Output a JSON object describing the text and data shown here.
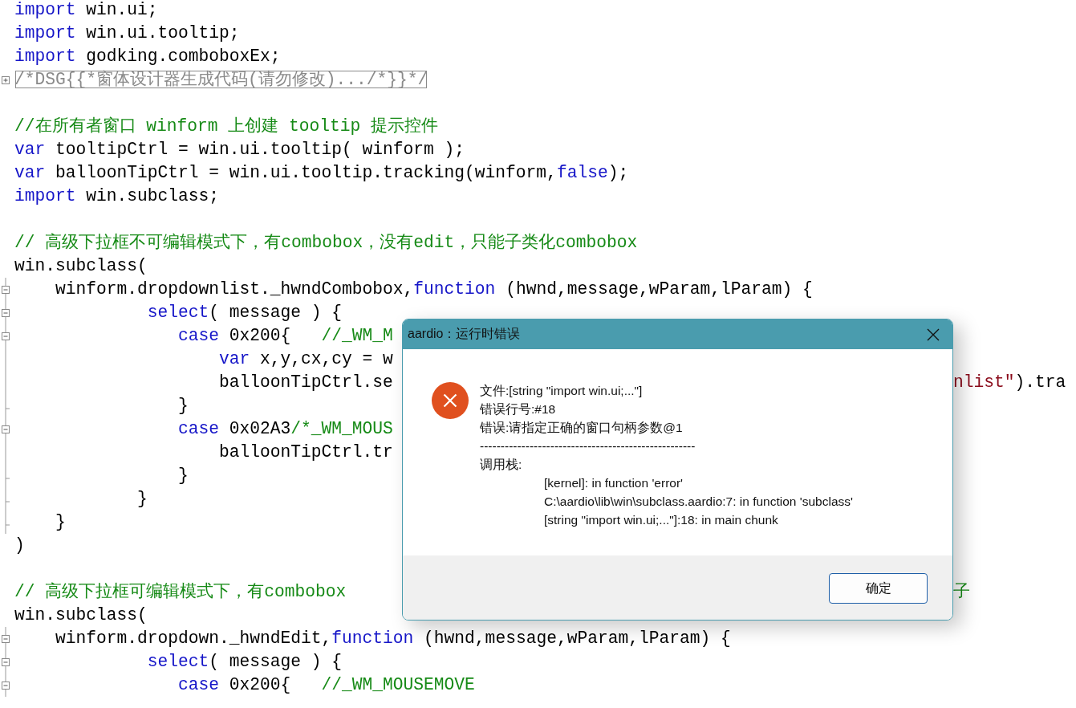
{
  "editor": {
    "lines": [
      {
        "kind": "code",
        "tokens": [
          {
            "kind": "keyword",
            "text": "import"
          },
          {
            "kind": "plain",
            "text": " win.ui;"
          }
        ]
      },
      {
        "kind": "code",
        "tokens": [
          {
            "kind": "keyword",
            "text": "import"
          },
          {
            "kind": "plain",
            "text": " win.ui.tooltip;"
          }
        ]
      },
      {
        "kind": "code",
        "tokens": [
          {
            "kind": "keyword",
            "text": "import"
          },
          {
            "kind": "plain",
            "text": " godking.comboboxEx;"
          }
        ]
      },
      {
        "kind": "code",
        "gutter": {
          "kind": "collapsed"
        },
        "tokens": [
          {
            "kind": "folded",
            "text": "/*DSG{{*窗体设计器生成代码(请勿修改).../*}}*/"
          }
        ]
      },
      {
        "kind": "blank"
      },
      {
        "kind": "code",
        "tokens": [
          {
            "kind": "comment",
            "text": "//在所有者窗口 winform 上创建 tooltip 提示控件"
          }
        ]
      },
      {
        "kind": "code",
        "tokens": [
          {
            "kind": "keyword",
            "text": "var"
          },
          {
            "kind": "plain",
            "text": " tooltipCtrl = win.ui.tooltip( winform );"
          }
        ]
      },
      {
        "kind": "code",
        "tokens": [
          {
            "kind": "keyword",
            "text": "var"
          },
          {
            "kind": "plain",
            "text": " balloonTipCtrl = win.ui.tooltip.tracking(winform,"
          },
          {
            "kind": "keyword",
            "text": "false"
          },
          {
            "kind": "plain",
            "text": ");"
          }
        ]
      },
      {
        "kind": "code",
        "tokens": [
          {
            "kind": "keyword",
            "text": "import"
          },
          {
            "kind": "plain",
            "text": " win.subclass;"
          }
        ]
      },
      {
        "kind": "blank"
      },
      {
        "kind": "code",
        "tokens": [
          {
            "kind": "comment",
            "text": "// 高级下拉框不可编辑模式下，有combobox，没有edit，只能子类化combobox"
          }
        ]
      },
      {
        "kind": "code",
        "tokens": [
          {
            "kind": "plain",
            "text": "win.subclass("
          }
        ]
      },
      {
        "kind": "code",
        "gutter": {
          "kind": "expanded"
        },
        "tokens": [
          {
            "kind": "plain",
            "text": "    winform.dropdownlist._hwndCombobox,"
          },
          {
            "kind": "keyword",
            "text": "function"
          },
          {
            "kind": "plain",
            "text": " (hwnd,message,wParam,lParam) {"
          }
        ]
      },
      {
        "kind": "code",
        "gutter": {
          "kind": "expanded"
        },
        "tokens": [
          {
            "kind": "keyword",
            "text": "             select"
          },
          {
            "kind": "plain",
            "text": "( message ) {"
          }
        ]
      },
      {
        "kind": "code",
        "gutter": {
          "kind": "expanded"
        },
        "tokens": [
          {
            "kind": "keyword",
            "text": "                case"
          },
          {
            "kind": "plain",
            "text": " 0x200{   "
          },
          {
            "kind": "comment",
            "text": "//_WM_M"
          }
        ]
      },
      {
        "kind": "code",
        "gutter": {
          "kind": "line"
        },
        "tokens": [
          {
            "kind": "keyword",
            "text": "                    var"
          },
          {
            "kind": "plain",
            "text": " x,y,cx,cy = w"
          }
        ]
      },
      {
        "kind": "code",
        "gutter": {
          "kind": "line"
        },
        "tokens": [
          {
            "kind": "plain",
            "text": "                    balloonTipCtrl.se"
          }
        ],
        "right_tokens": [
          {
            "kind": "string",
            "text": "nlist\""
          },
          {
            "kind": "plain",
            "text": ").tra"
          }
        ]
      },
      {
        "kind": "code",
        "gutter": {
          "kind": "end"
        },
        "tokens": [
          {
            "kind": "plain",
            "text": "                }"
          }
        ]
      },
      {
        "kind": "code",
        "gutter": {
          "kind": "expanded"
        },
        "tokens": [
          {
            "kind": "keyword",
            "text": "                case"
          },
          {
            "kind": "plain",
            "text": " 0x02A3"
          },
          {
            "kind": "comment",
            "text": "/*_WM_MOUS"
          }
        ]
      },
      {
        "kind": "code",
        "gutter": {
          "kind": "line"
        },
        "tokens": [
          {
            "kind": "plain",
            "text": "                    balloonTipCtrl.tr"
          }
        ]
      },
      {
        "kind": "code",
        "gutter": {
          "kind": "end"
        },
        "tokens": [
          {
            "kind": "plain",
            "text": "                }"
          }
        ]
      },
      {
        "kind": "code",
        "gutter": {
          "kind": "end"
        },
        "tokens": [
          {
            "kind": "plain",
            "text": "            }"
          }
        ]
      },
      {
        "kind": "code",
        "gutter": {
          "kind": "end"
        },
        "tokens": [
          {
            "kind": "plain",
            "text": "    }"
          }
        ]
      },
      {
        "kind": "code",
        "tokens": [
          {
            "kind": "plain",
            "text": ")"
          }
        ]
      },
      {
        "kind": "blank"
      },
      {
        "kind": "code",
        "tokens": [
          {
            "kind": "comment",
            "text": "// 高级下拉框可编辑模式下，有combobox"
          }
        ],
        "right_tokens": [
          {
            "kind": "comment",
            "text": "子"
          }
        ]
      },
      {
        "kind": "code",
        "tokens": [
          {
            "kind": "plain",
            "text": "win.subclass("
          }
        ]
      },
      {
        "kind": "code",
        "gutter": {
          "kind": "expanded"
        },
        "tokens": [
          {
            "kind": "plain",
            "text": "    winform.dropdown._hwndEdit,"
          },
          {
            "kind": "keyword",
            "text": "function"
          },
          {
            "kind": "plain",
            "text": " (hwnd,message,wParam,lParam) {"
          }
        ]
      },
      {
        "kind": "code",
        "gutter": {
          "kind": "expanded"
        },
        "tokens": [
          {
            "kind": "keyword",
            "text": "             select"
          },
          {
            "kind": "plain",
            "text": "( message ) {"
          }
        ]
      },
      {
        "kind": "code",
        "gutter": {
          "kind": "expanded"
        },
        "tokens": [
          {
            "kind": "keyword",
            "text": "                case"
          },
          {
            "kind": "plain",
            "text": " 0x200{   "
          },
          {
            "kind": "comment",
            "text": "//_WM_MOUSEMOVE"
          }
        ]
      }
    ]
  },
  "dialog": {
    "title": "aardio：运行时错误",
    "message_lines": [
      "文件:[string \"import win.ui;...\"]",
      "错误行号:#18",
      "错误:请指定正确的窗口句柄参数@1"
    ],
    "separator": "----------------------------------------------------",
    "stack_label": "调用栈:",
    "stack": [
      "[kernel]: in function 'error'",
      "C:\\aardio\\lib\\win\\subclass.aardio:7: in function 'subclass'",
      "[string \"import win.ui;...\"]:18: in main chunk"
    ],
    "button": "确定"
  }
}
